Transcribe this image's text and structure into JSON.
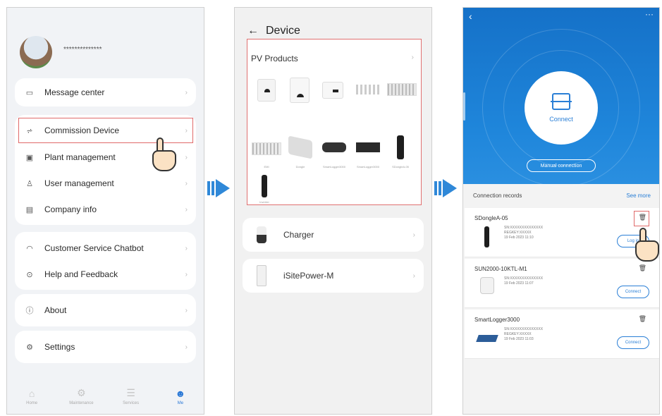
{
  "panel1": {
    "username_masked": "**************",
    "menu_group1": [
      {
        "icon": "message-icon",
        "glyph": "▭",
        "label": "Message center"
      }
    ],
    "menu_group2": [
      {
        "icon": "commission-icon",
        "glyph": "⩫",
        "label": "Commission Device"
      },
      {
        "icon": "plant-icon",
        "glyph": "▣",
        "label": "Plant management"
      },
      {
        "icon": "user-icon",
        "glyph": "♙",
        "label": "User management"
      },
      {
        "icon": "company-icon",
        "glyph": "▤",
        "label": "Company info"
      }
    ],
    "menu_group3": [
      {
        "icon": "chatbot-icon",
        "glyph": "◠",
        "label": "Customer Service Chatbot"
      },
      {
        "icon": "help-icon",
        "glyph": "⊙",
        "label": "Help and Feedback"
      }
    ],
    "menu_group4": [
      {
        "icon": "about-icon",
        "glyph": "ⓘ",
        "label": "About"
      }
    ],
    "menu_group5": [
      {
        "icon": "settings-icon",
        "glyph": "⚙",
        "label": "Settings"
      }
    ],
    "tabs": [
      {
        "icon": "home-icon",
        "glyph": "⌂",
        "label": "Home"
      },
      {
        "icon": "maintenance-icon",
        "glyph": "⚙",
        "label": "Maintenance"
      },
      {
        "icon": "services-icon",
        "glyph": "☰",
        "label": "Services"
      },
      {
        "icon": "me-icon",
        "glyph": "☻",
        "label": "Me"
      }
    ]
  },
  "panel2": {
    "title": "Device",
    "pv_title": "PV Products",
    "pv_labels": [
      "EMI",
      "Dongle",
      "SmartLogger3000",
      "SmartLogger3000",
      "SDongleA-05"
    ],
    "pv_last_label": "Inverter",
    "devices": [
      {
        "label": "Charger"
      },
      {
        "label": "iSitePower-M"
      }
    ]
  },
  "panel3": {
    "connect_label": "Connect",
    "manual_label": "Manual connection",
    "records_title": "Connection records",
    "see_more": "See more",
    "records": [
      {
        "name": "SDongleA-05",
        "sn": "SN:XXXXXXXXXXXXXX",
        "regkey": "REGKEY:XXXXX",
        "date": "19 Feb 2023 11:10",
        "button": "Log in"
      },
      {
        "name": "SUN2000-10KTL-M1",
        "sn": "SN:XXXXXXXXXXXXXX",
        "date": "19 Feb 2023 11:07",
        "button": "Connect"
      },
      {
        "name": "SmartLogger3000",
        "sn": "SN:XXXXXXXXXXXXXX",
        "regkey": "REGKEY:XXXXX",
        "date": "19 Feb 2023 11:03",
        "button": "Connect"
      }
    ]
  },
  "colors": {
    "accent": "#2a7fd6",
    "arrow": "#2f88d8",
    "highlight": "#e06a6a"
  }
}
